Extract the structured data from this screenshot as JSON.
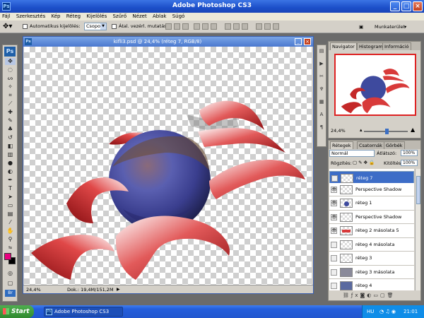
{
  "window": {
    "title": "Adobe Photoshop CS3",
    "app_badge": "Ps"
  },
  "menu": [
    "Fájl",
    "Szerkesztés",
    "Kép",
    "Réteg",
    "Kijelölés",
    "Szűrő",
    "Nézet",
    "Ablak",
    "Súgó"
  ],
  "options_bar": {
    "auto_select_label": "Automatikus kijelölés:",
    "auto_select_value": "Csoport",
    "transform_controls_label": "Átal. vezérl. mutatása",
    "workspace_label": "Munkaterület"
  },
  "document": {
    "title": "kifli3.psd @ 24,4% (réteg 7, RGB/8)",
    "zoom": "24,4%",
    "doc_size": "Dok.: 19,4M/151,2M"
  },
  "navigator": {
    "tabs": [
      "Navigator",
      "Histogram",
      "Információ"
    ],
    "zoom": "24,4%"
  },
  "layers": {
    "tabs": [
      "Rétegek",
      "Csatornák",
      "Görbék"
    ],
    "blend_mode": "Normál",
    "opacity_label": "Átlátszó:",
    "opacity_value": "100%",
    "lock_label": "Rögzítés:",
    "fill_label": "Kitöltés:",
    "fill_value": "100%",
    "items": [
      {
        "name": "réteg 7",
        "visible": false,
        "selected": true
      },
      {
        "name": "Perspective Shadow",
        "visible": true,
        "selected": false
      },
      {
        "name": "réteg 1",
        "visible": true,
        "selected": false
      },
      {
        "name": "Perspective Shadow",
        "visible": true,
        "selected": false
      },
      {
        "name": "réteg 2 másolata 5",
        "visible": true,
        "selected": false
      },
      {
        "name": "réteg 4 másolata",
        "visible": false,
        "selected": false
      },
      {
        "name": "réteg 3",
        "visible": false,
        "selected": false
      },
      {
        "name": "réteg 3 másolata",
        "visible": false,
        "selected": false
      },
      {
        "name": "réteg 4",
        "visible": false,
        "selected": false
      }
    ]
  },
  "taskbar": {
    "start_label": "Start",
    "task_item": "Adobe Photoshop CS3",
    "language": "HU",
    "clock": "21:01"
  },
  "colors": {
    "foreground": "#e8007f",
    "background": "#000000",
    "selection": "#3d6dc7",
    "titlebar": "#1c4fc9"
  }
}
